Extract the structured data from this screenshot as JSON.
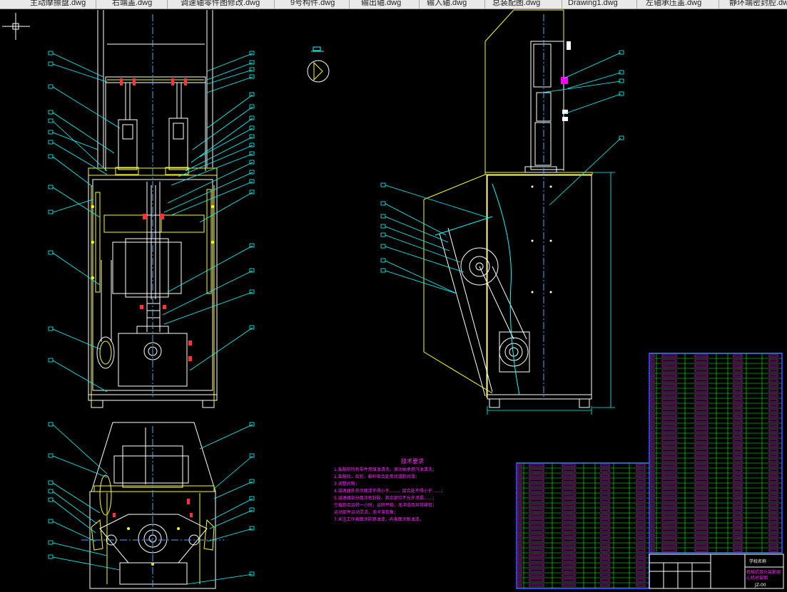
{
  "tabs": [
    {
      "label": "主动摩擦盘.dwg"
    },
    {
      "label": "右端盖.dwg"
    },
    {
      "label": "调速轴零件图修改.dwg"
    },
    {
      "label": "9号构件.dwg"
    },
    {
      "label": "输出轴.dwg"
    },
    {
      "label": "输入轴.dwg"
    },
    {
      "label": "总装配图.dwg"
    },
    {
      "label": "Drawing1.dwg"
    },
    {
      "label": "左轴承压盖.dwg"
    },
    {
      "label": "静环端密封腔.dwg"
    }
  ],
  "tech_requirements": {
    "title": "技术要求",
    "lines": [
      "1.装配前所有零件用煤油清洗，滚动轴承用汽油清洗；",
      "2.装配后，齿轮、蜗杆啮合处用润滑脂润滑；",
      "3.调整间隙；",
      "4.减速器外壳涂面漆不得小于……，接合处不得小于……；",
      "5.减速器剖分面涂密封胶，其余部位不允许渗漏……；",
      "空载跑合运转一小时，运转平稳，无冲击及异常噪音；",
      "运动部件运动灵活，无卡滞现象；",
      "7.未注工作表面涂防锈油漆，内表面涂耐油漆。"
    ]
  },
  "title_block": {
    "school_label": "学校名称",
    "drawing_name": "机械式双头装配调心机总装图",
    "drawing_no": "JZ-00"
  },
  "colors": {
    "background": "#000000",
    "leader": "#00ffff",
    "outline": "#ffffff",
    "housing": "#ffff00",
    "table_grid": "#00ff00",
    "table_border": "#3333ff",
    "highlight": "#ff00ff",
    "fastener": "#ff3333"
  }
}
